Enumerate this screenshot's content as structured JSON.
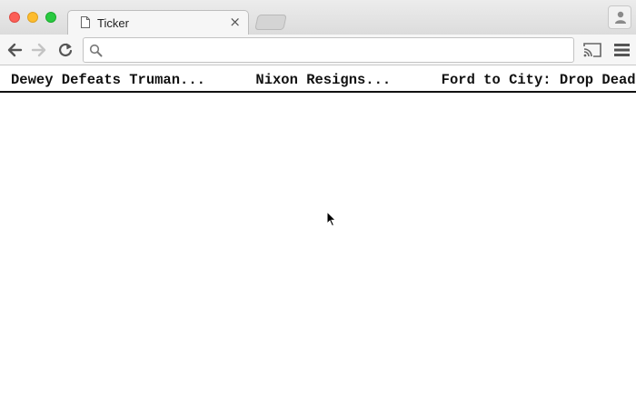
{
  "window": {
    "tab_title": "Ticker",
    "tab_close_glyph": "×"
  },
  "toolbar": {
    "address_value": "",
    "address_placeholder": ""
  },
  "ticker": {
    "headlines": [
      "Dewey Defeats Truman...",
      "Nixon Resigns...",
      "Ford to City: Drop Dead"
    ]
  },
  "icons": {
    "doc": "document-icon",
    "back": "back-arrow-icon",
    "forward": "forward-arrow-icon",
    "reload": "reload-icon",
    "search": "search-icon",
    "cast": "cast-icon",
    "menu": "menu-icon",
    "profile": "profile-icon",
    "cursor": "mouse-pointer-icon"
  },
  "colors": {
    "close": "#fc5f57",
    "minimize": "#fdbc2e",
    "maximize": "#29c940"
  }
}
